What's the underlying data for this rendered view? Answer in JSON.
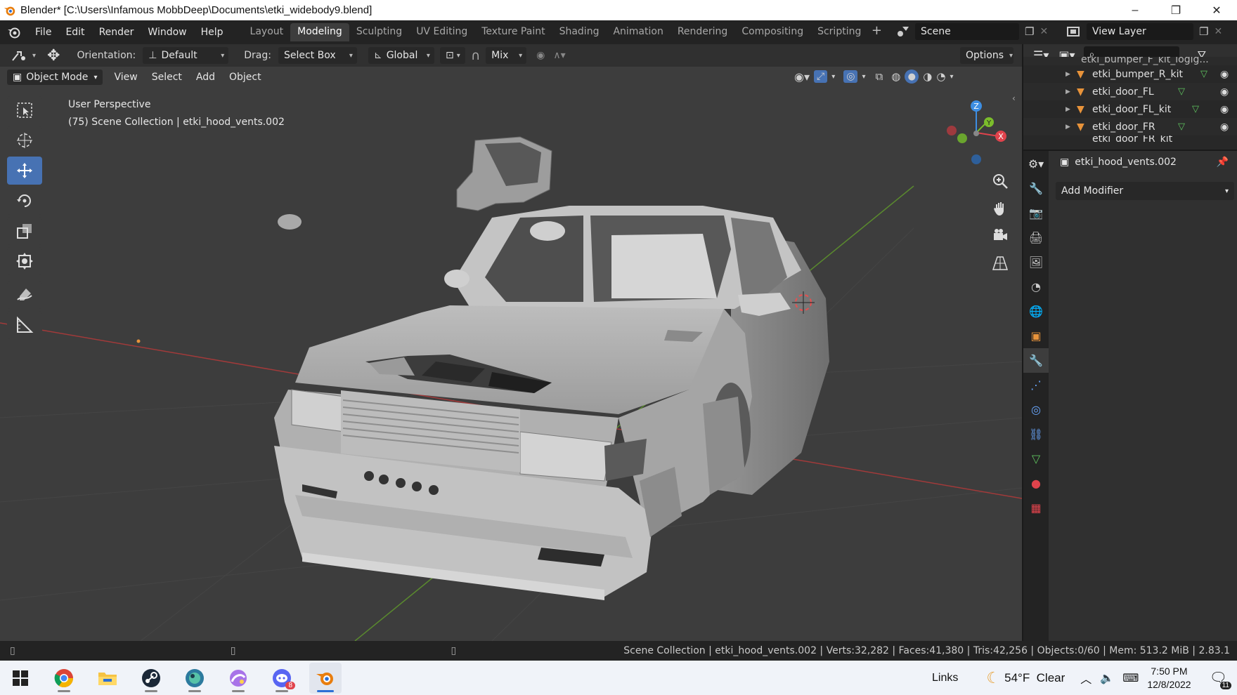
{
  "window": {
    "title": "Blender* [C:\\Users\\Infamous MobbDeep\\Documents\\etki_widebody9.blend]",
    "minimize": "–",
    "maximize": "❐",
    "close": "✕"
  },
  "menu": [
    "File",
    "Edit",
    "Render",
    "Window",
    "Help"
  ],
  "workspaces": [
    "Layout",
    "Modeling",
    "Sculpting",
    "UV Editing",
    "Texture Paint",
    "Shading",
    "Animation",
    "Rendering",
    "Compositing",
    "Scripting"
  ],
  "active_workspace": "Modeling",
  "scene": {
    "name": "Scene"
  },
  "view_layer": {
    "name": "View Layer"
  },
  "tool_header": {
    "orientation_label": "Orientation:",
    "orientation_value": "Default",
    "drag_label": "Drag:",
    "drag_value": "Select Box",
    "transform_space": "Global",
    "snap_mode": "Mix",
    "options_label": "Options"
  },
  "viewport_header": {
    "mode": "Object Mode",
    "menus": [
      "View",
      "Select",
      "Add",
      "Object"
    ]
  },
  "viewport_info": {
    "perspective": "User Perspective",
    "collection": "(75) Scene Collection | etki_hood_vents.002"
  },
  "gizmo": {
    "z": "Z",
    "y": "Y",
    "x": "X"
  },
  "outliner": {
    "items": [
      {
        "name": "etki_bumper_F_kit_logig..."
      },
      {
        "name": "etki_bumper_R_kit"
      },
      {
        "name": "etki_door_FL"
      },
      {
        "name": "etki_door_FL_kit"
      },
      {
        "name": "etki_door_FR"
      },
      {
        "name": "etki_door_FR_kit"
      }
    ]
  },
  "properties": {
    "object_name": "etki_hood_vents.002",
    "add_modifier": "Add Modifier"
  },
  "statusbar": {
    "stats": "Scene Collection | etki_hood_vents.002 | Verts:32,282 | Faces:41,380 | Tris:42,256 | Objects:0/60 | Mem: 513.2 MiB | 2.83.1"
  },
  "taskbar": {
    "links_label": "Links",
    "weather": "54°F  Clear",
    "time": "7:50 PM",
    "date": "12/8/2022",
    "notification_count": "11",
    "discord_badge": "8"
  },
  "colors": {
    "accent": "#4772b3",
    "axis_x": "#e0434c",
    "axis_y": "#7bbd2b",
    "axis_z": "#3d8ee3",
    "orange": "#e8933a"
  }
}
